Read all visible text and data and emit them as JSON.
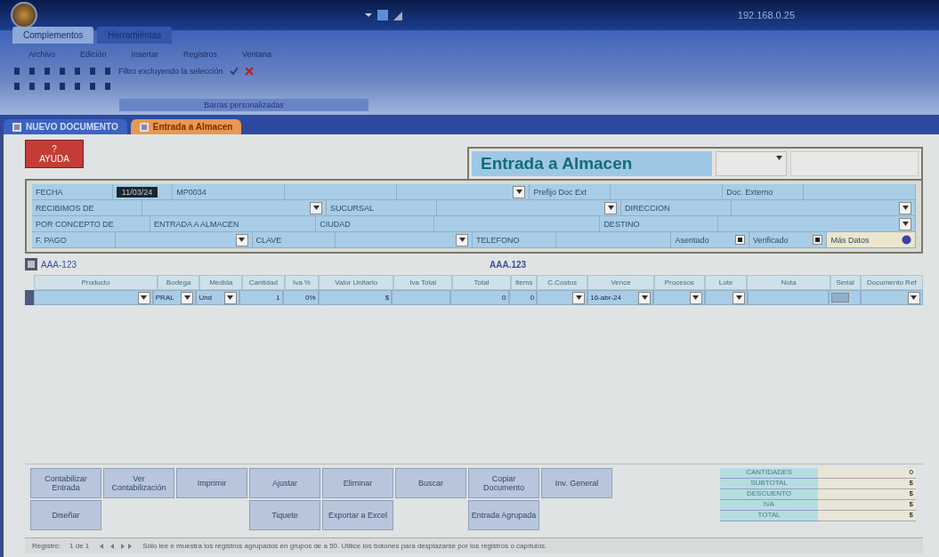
{
  "title_bar": {
    "address": "192.168.0.25"
  },
  "ribbon": {
    "tabs": [
      {
        "label": "Complementos",
        "selected": true
      },
      {
        "label": "Herramientas",
        "selected": false
      }
    ],
    "menus": [
      "Archivo",
      "Edición",
      "Insertar",
      "Registros",
      "Ventana"
    ],
    "toolbar_text": "Filtro excluyendo la selección",
    "group_label": "Barras personalizadas"
  },
  "doc_tabs": [
    {
      "label": "NUEVO DOCUMENTO",
      "selected": false
    },
    {
      "label": "Entrada a Almacen",
      "selected": true
    }
  ],
  "help_button": {
    "icon": "?",
    "label": "AYUDA"
  },
  "form_title": "Entrada a Almacen",
  "header_rows": [
    [
      {
        "kind": "label",
        "text": "FECHA"
      },
      {
        "kind": "selected",
        "text": "11/03/24"
      },
      {
        "kind": "value",
        "text": "MP0034"
      },
      {
        "kind": "value"
      },
      {
        "kind": "combo"
      },
      {
        "kind": "label",
        "text": "Prefijo Doc Ext"
      },
      {
        "kind": "value"
      },
      {
        "kind": "label",
        "text": "Doc. Externo"
      },
      {
        "kind": "value"
      }
    ],
    [
      {
        "kind": "label",
        "text": "RECIBIMOS DE"
      },
      {
        "kind": "combo"
      },
      {
        "kind": "label",
        "text": "SUCURSAL"
      },
      {
        "kind": "combo"
      },
      {
        "kind": "label",
        "text": "DIRECCION"
      },
      {
        "kind": "combo"
      }
    ],
    [
      {
        "kind": "label",
        "text": "POR CONCEPTO DE"
      },
      {
        "kind": "value",
        "text": "ENTRADA A ALMACEN"
      },
      {
        "kind": "label",
        "text": "CIUDAD"
      },
      {
        "kind": "value"
      },
      {
        "kind": "label",
        "text": "DESTINO"
      },
      {
        "kind": "combo"
      }
    ],
    [
      {
        "kind": "label",
        "text": "F. PAGO"
      },
      {
        "kind": "combo"
      },
      {
        "kind": "label",
        "text": "CLAVE"
      },
      {
        "kind": "combo"
      },
      {
        "kind": "label",
        "text": "TELEFONO"
      },
      {
        "kind": "value"
      },
      {
        "kind": "check",
        "text": "Asentado",
        "checked": true
      },
      {
        "kind": "check",
        "text": "Verificado",
        "checked": true
      },
      {
        "kind": "more",
        "text": "Más Datos"
      }
    ]
  ],
  "record_code": "AAA-123",
  "record_code_center": "AAA.123",
  "grid": {
    "columns": [
      "Producto",
      "Bodega",
      "Medida",
      "Cantidad",
      "Iva %",
      "Valor Unitario",
      "Iva Total",
      "Total",
      "Items",
      "C.Costos",
      "Vence",
      "Procesos",
      "Lote",
      "Nota",
      "Serial",
      "Documento Ref"
    ],
    "row": [
      {
        "kind": "combo"
      },
      {
        "kind": "combo",
        "text": "PRAL"
      },
      {
        "kind": "combo",
        "text": "Und"
      },
      {
        "kind": "text",
        "text": "1"
      },
      {
        "kind": "text",
        "text": "0%"
      },
      {
        "kind": "text",
        "text": "$"
      },
      {
        "kind": "text"
      },
      {
        "kind": "text",
        "text": "0"
      },
      {
        "kind": "text",
        "text": "0"
      },
      {
        "kind": "combo"
      },
      {
        "kind": "combo",
        "text": "16-abr-24"
      },
      {
        "kind": "combo"
      },
      {
        "kind": "combo"
      },
      {
        "kind": "text"
      },
      {
        "kind": "check",
        "checked": false
      },
      {
        "kind": "combo"
      }
    ]
  },
  "buttons": [
    [
      {
        "kind": "button",
        "label": "Contabilizar Entrada"
      },
      {
        "kind": "button",
        "label": "Ver Contabilización"
      },
      {
        "kind": "button",
        "label": "Imprimir"
      },
      {
        "kind": "button",
        "label": "Ajustar"
      },
      {
        "kind": "button",
        "label": "Eliminar"
      },
      {
        "kind": "button",
        "label": "Buscar"
      },
      {
        "kind": "button",
        "label": "Copiar Documento"
      },
      {
        "kind": "button",
        "label": "Inv. General"
      }
    ],
    [
      {
        "kind": "button",
        "label": "Diseñar"
      },
      {
        "kind": "empty"
      },
      {
        "kind": "empty"
      },
      {
        "kind": "button",
        "label": "Tiquete"
      },
      {
        "kind": "button",
        "label": "Exportar a Excel"
      },
      {
        "kind": "empty"
      },
      {
        "kind": "button",
        "label": "Entrada Agrupada"
      },
      {
        "kind": "empty"
      }
    ]
  ],
  "totals": [
    {
      "label": "CANTIDADES",
      "value": "0"
    },
    {
      "label": "SUBTOTAL",
      "value": "$"
    },
    {
      "label": "DESCUENTO",
      "value": "$"
    },
    {
      "label": "IVA",
      "value": "$"
    },
    {
      "label": "TOTAL",
      "value": "$"
    }
  ],
  "status_bar": {
    "label": "Registro:",
    "position": "1 de 1",
    "hint": "Sólo lee e muestra los registros agrupados en grupos de a 50. Utilice los botones para desplazarse por los registros o capítulos."
  }
}
